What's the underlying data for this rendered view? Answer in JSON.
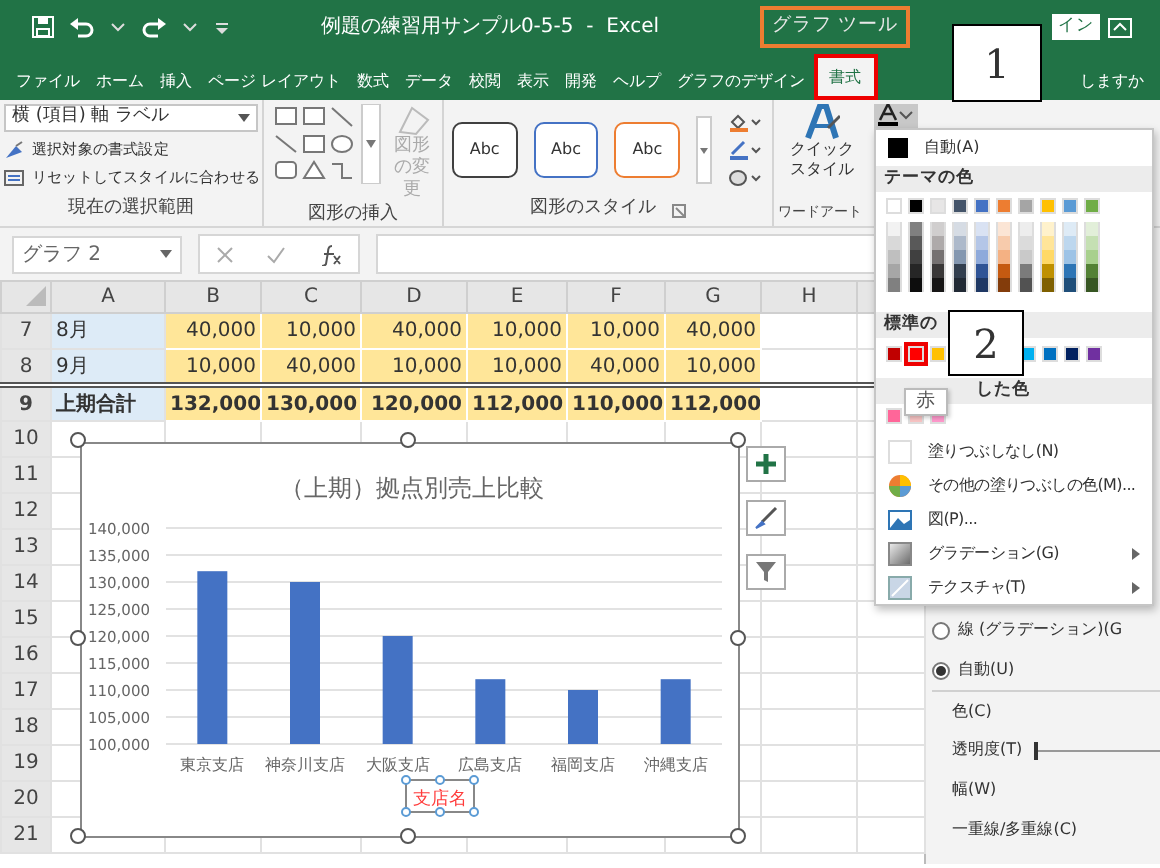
{
  "title_bar": {
    "title": "例題の練習用サンプル0-5-5  -  Excel",
    "context_group": "グラフ ツール",
    "account": "イン"
  },
  "ribbon_tabs": [
    {
      "label": "ファイル",
      "selected": false
    },
    {
      "label": "ホーム",
      "selected": false
    },
    {
      "label": "挿入",
      "selected": false
    },
    {
      "label": "ページ レイアウト",
      "selected": false
    },
    {
      "label": "数式",
      "selected": false
    },
    {
      "label": "データ",
      "selected": false
    },
    {
      "label": "校閲",
      "selected": false
    },
    {
      "label": "表示",
      "selected": false
    },
    {
      "label": "開発",
      "selected": false
    },
    {
      "label": "ヘルプ",
      "selected": false
    },
    {
      "label": "グラフのデザイン",
      "selected": false
    },
    {
      "label": "書式",
      "selected": true
    }
  ],
  "tell_me": "しますか",
  "ribbon": {
    "current_selection": {
      "element_dropdown": "横 (項目) 軸 ラベル",
      "commands": [
        "選択対象の書式設定",
        "リセットしてスタイルに合わせる"
      ],
      "label": "現在の選択範囲"
    },
    "insert_shapes": {
      "change_shape": "図形の変更",
      "disabled": true,
      "label": "図形の挿入"
    },
    "shape_styles": {
      "presets": [
        {
          "label": "Abc",
          "color": "#404040"
        },
        {
          "label": "Abc",
          "color": "#4472c4"
        },
        {
          "label": "Abc",
          "color": "#ed7d31"
        }
      ],
      "label": "図形のスタイル"
    },
    "wordart": {
      "quick_style": [
        "クイック",
        "スタイル"
      ],
      "label": "ワードアート"
    },
    "font_color_button": {
      "expanded": true
    }
  },
  "formula_bar": {
    "name_box": "グラフ 2"
  },
  "sheet": {
    "columns": [
      "A",
      "B",
      "C",
      "D",
      "E",
      "F",
      "G",
      "H"
    ],
    "rows": [
      {
        "number": "7",
        "total": false,
        "cells": [
          "8月",
          "40,000",
          "10,000",
          "40,000",
          "10,000",
          "10,000",
          "40,000"
        ]
      },
      {
        "number": "8",
        "total": false,
        "cells": [
          "9月",
          "10,000",
          "40,000",
          "10,000",
          "10,000",
          "40,000",
          "10,000"
        ]
      },
      {
        "number": "9",
        "total": true,
        "cells": [
          "上期合計",
          "132,000",
          "130,000",
          "120,000",
          "112,000",
          "110,000",
          "112,000"
        ]
      }
    ],
    "empty_rows": [
      "10",
      "11",
      "12",
      "13",
      "14",
      "15",
      "16",
      "17",
      "18",
      "19",
      "20",
      "21"
    ]
  },
  "chart": {
    "chart_data": {
      "type": "bar",
      "title": "（上期）拠点別売上比較",
      "xlabel": "支店名",
      "categories": [
        "東京支店",
        "神奈川支店",
        "大阪支店",
        "広島支店",
        "福岡支店",
        "沖縄支店"
      ],
      "grid": true,
      "series": [
        {
          "color": "#4472c4",
          "values": [
            132000,
            130000,
            120000,
            112000,
            110000,
            112000
          ]
        }
      ],
      "ylim": [
        100000,
        140000
      ],
      "yticks": [
        {
          "value": 100000,
          "label": "100,000"
        },
        {
          "value": 105000,
          "label": "105,000"
        },
        {
          "value": 110000,
          "label": "110,000"
        },
        {
          "value": 115000,
          "label": "115,000"
        },
        {
          "value": 120000,
          "label": "120,000"
        },
        {
          "value": 125000,
          "label": "125,000"
        },
        {
          "value": 130000,
          "label": "130,000"
        },
        {
          "value": 135000,
          "label": "135,000"
        },
        {
          "value": 140000,
          "label": "140,000"
        }
      ]
    },
    "xlabel_selected": true
  },
  "fill_menu": {
    "automatic": "自動(A)",
    "theme_header": "テーマの色",
    "theme_colors": [
      [
        {
          "color": "#ffffff"
        },
        {
          "color": "#000000"
        },
        {
          "color": "#e7e6e6"
        },
        {
          "color": "#44546a"
        },
        {
          "color": "#4472c4"
        },
        {
          "color": "#ed7d31"
        },
        {
          "color": "#a5a5a5"
        },
        {
          "color": "#ffc000"
        },
        {
          "color": "#5b9bd5"
        },
        {
          "color": "#70ad47"
        }
      ],
      [
        {
          "color": "#f2f2f2"
        },
        {
          "color": "#808080"
        },
        {
          "color": "#d0cece"
        },
        {
          "color": "#d6dce4"
        },
        {
          "color": "#d9e2f3"
        },
        {
          "color": "#fbe5d5"
        },
        {
          "color": "#ededed"
        },
        {
          "color": "#fff2cc"
        },
        {
          "color": "#deebf6"
        },
        {
          "color": "#e2efd9"
        }
      ],
      [
        {
          "color": "#d9d9d9"
        },
        {
          "color": "#595959"
        },
        {
          "color": "#aeaaaa"
        },
        {
          "color": "#adb9ca"
        },
        {
          "color": "#b4c6e7"
        },
        {
          "color": "#f7cbac"
        },
        {
          "color": "#dbdbdb"
        },
        {
          "color": "#ffe599"
        },
        {
          "color": "#bdd7ee"
        },
        {
          "color": "#c5e0b3"
        }
      ],
      [
        {
          "color": "#bfbfbf"
        },
        {
          "color": "#404040"
        },
        {
          "color": "#757171"
        },
        {
          "color": "#8497b0"
        },
        {
          "color": "#8eaadb"
        },
        {
          "color": "#f4b183"
        },
        {
          "color": "#c9c9c9"
        },
        {
          "color": "#ffd966"
        },
        {
          "color": "#9dc3e6"
        },
        {
          "color": "#a8d08d"
        }
      ],
      [
        {
          "color": "#a6a6a6"
        },
        {
          "color": "#262626"
        },
        {
          "color": "#3a3838"
        },
        {
          "color": "#333f4f"
        },
        {
          "color": "#2f5496"
        },
        {
          "color": "#c55a11"
        },
        {
          "color": "#7b7b7b"
        },
        {
          "color": "#bf9000"
        },
        {
          "color": "#2e75b5"
        },
        {
          "color": "#538135"
        }
      ],
      [
        {
          "color": "#808080"
        },
        {
          "color": "#0d0d0d"
        },
        {
          "color": "#171616"
        },
        {
          "color": "#222a35"
        },
        {
          "color": "#1f3864"
        },
        {
          "color": "#833c0b"
        },
        {
          "color": "#525252"
        },
        {
          "color": "#7f6000"
        },
        {
          "color": "#1f4e79"
        },
        {
          "color": "#375623"
        }
      ]
    ],
    "standard_header": "標準の",
    "standard_colors": [
      {
        "color": "#c00000",
        "selected": false
      },
      {
        "color": "#ff0000",
        "selected": true
      },
      {
        "color": "#ffc000",
        "selected": false
      }
    ],
    "standard_colors_more": [
      {
        "color": "#00b0f0",
        "selected": false
      },
      {
        "color": "#0070c0",
        "selected": false
      },
      {
        "color": "#002060",
        "selected": false
      },
      {
        "color": "#7030a0",
        "selected": false
      }
    ],
    "recent_header": "した色",
    "recent_colors": [
      {
        "color": "#ff6699"
      },
      {
        "color": "#f8c4c4"
      },
      {
        "color": "#ff99cc"
      }
    ],
    "items": [
      {
        "kind": "none",
        "label": "塗りつぶしなし(N)",
        "submenu": false
      },
      {
        "kind": "more",
        "label": "その他の塗りつぶしの色(M)...",
        "submenu": false
      },
      {
        "kind": "picture",
        "label": "図(P)...",
        "submenu": false
      },
      {
        "kind": "gradient",
        "label": "グラデーション(G)",
        "submenu": true
      },
      {
        "kind": "texture",
        "label": "テクスチャ(T)",
        "submenu": true
      }
    ]
  },
  "tooltip": "赤",
  "format_pane": {
    "options": [
      {
        "kind": "radio",
        "label": "線 (グラデーション)(G",
        "selected": false
      },
      {
        "kind": "radio",
        "label": "自動(U)",
        "selected": true
      },
      {
        "kind": "label",
        "label": "色(C)"
      },
      {
        "kind": "slider",
        "label": "透明度(T)",
        "level": 0
      },
      {
        "kind": "label",
        "label": "幅(W)"
      },
      {
        "kind": "label",
        "label": "一重線/多重線(C)"
      }
    ]
  },
  "callouts": [
    "1",
    "2"
  ]
}
